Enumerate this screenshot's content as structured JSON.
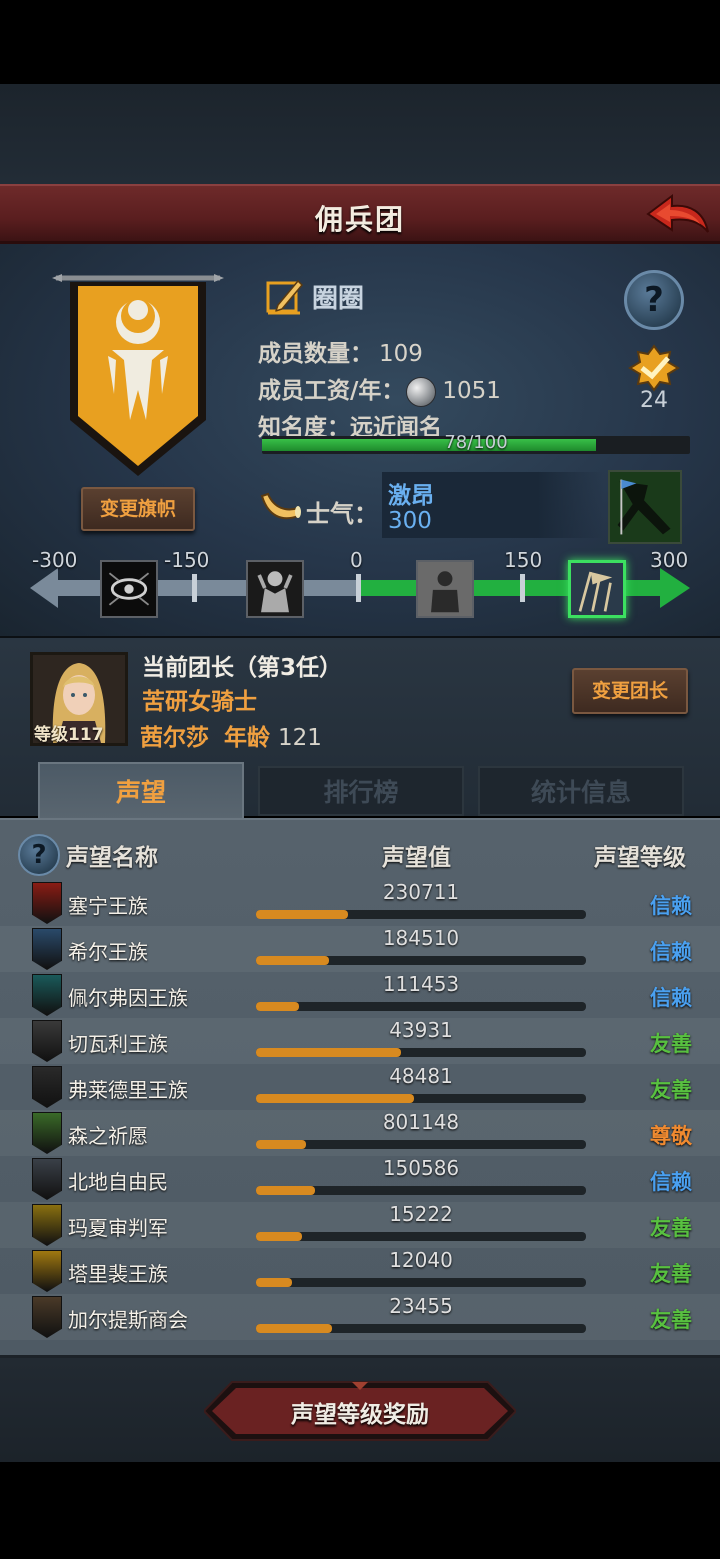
{
  "header": {
    "title": "佣兵团"
  },
  "guild": {
    "name": "圈圈",
    "members_label": "成员数量：",
    "members_value": "109",
    "wage_label": "成员工资/年：",
    "wage_value": "1051",
    "fame_label": "知名度：",
    "fame_value": "远近闻名",
    "fame_progress": "78/100",
    "fame_fraction": 0.78,
    "change_banner_label": "变更旗帜",
    "badge_value": "24"
  },
  "morale": {
    "label": "士气：",
    "status": "激昂",
    "value": "300",
    "scale_ticks": [
      "-300",
      "-150",
      "0",
      "150",
      "300"
    ]
  },
  "leader": {
    "title": "当前团长（第3任）",
    "class": "苦研女骑士",
    "name": "茜尔莎",
    "age_label": "年龄",
    "age_value": "121",
    "level": "等级117",
    "change_leader_label": "变更团长"
  },
  "tabs": [
    "声望",
    "排行榜",
    "统计信息"
  ],
  "reputation": {
    "headers": {
      "name": "声望名称",
      "value": "声望值",
      "level": "声望等级"
    },
    "rows": [
      {
        "name": "塞宁王族",
        "value": "230711",
        "fill": 0.28,
        "level": "信赖",
        "level_color": "#4aa0f0",
        "icon_color": "#8a1c14"
      },
      {
        "name": "希尔王族",
        "value": "184510",
        "fill": 0.22,
        "level": "信赖",
        "level_color": "#4aa0f0",
        "icon_color": "#2a4a6a"
      },
      {
        "name": "佩尔弗因王族",
        "value": "111453",
        "fill": 0.13,
        "level": "信赖",
        "level_color": "#4aa0f0",
        "icon_color": "#1a5a5a"
      },
      {
        "name": "切瓦利王族",
        "value": "43931",
        "fill": 0.44,
        "level": "友善",
        "level_color": "#58c040",
        "icon_color": "#3a3a3a"
      },
      {
        "name": "弗莱德里王族",
        "value": "48481",
        "fill": 0.48,
        "level": "友善",
        "level_color": "#58c040",
        "icon_color": "#2a2a2a"
      },
      {
        "name": "森之祈愿",
        "value": "801148",
        "fill": 0.15,
        "level": "尊敬",
        "level_color": "#f08a30",
        "icon_color": "#3a6a28"
      },
      {
        "name": "北地自由民",
        "value": "150586",
        "fill": 0.18,
        "level": "信赖",
        "level_color": "#4aa0f0",
        "icon_color": "#3a4048"
      },
      {
        "name": "玛夏审判军",
        "value": "15222",
        "fill": 0.14,
        "level": "友善",
        "level_color": "#58c040",
        "icon_color": "#8a7010"
      },
      {
        "name": "塔里裴王族",
        "value": "12040",
        "fill": 0.11,
        "level": "友善",
        "level_color": "#58c040",
        "icon_color": "#a07810"
      },
      {
        "name": "加尔提斯商会",
        "value": "23455",
        "fill": 0.23,
        "level": "友善",
        "level_color": "#58c040",
        "icon_color": "#4a3a28"
      }
    ]
  },
  "footer": {
    "reward_label": "声望等级奖励"
  }
}
